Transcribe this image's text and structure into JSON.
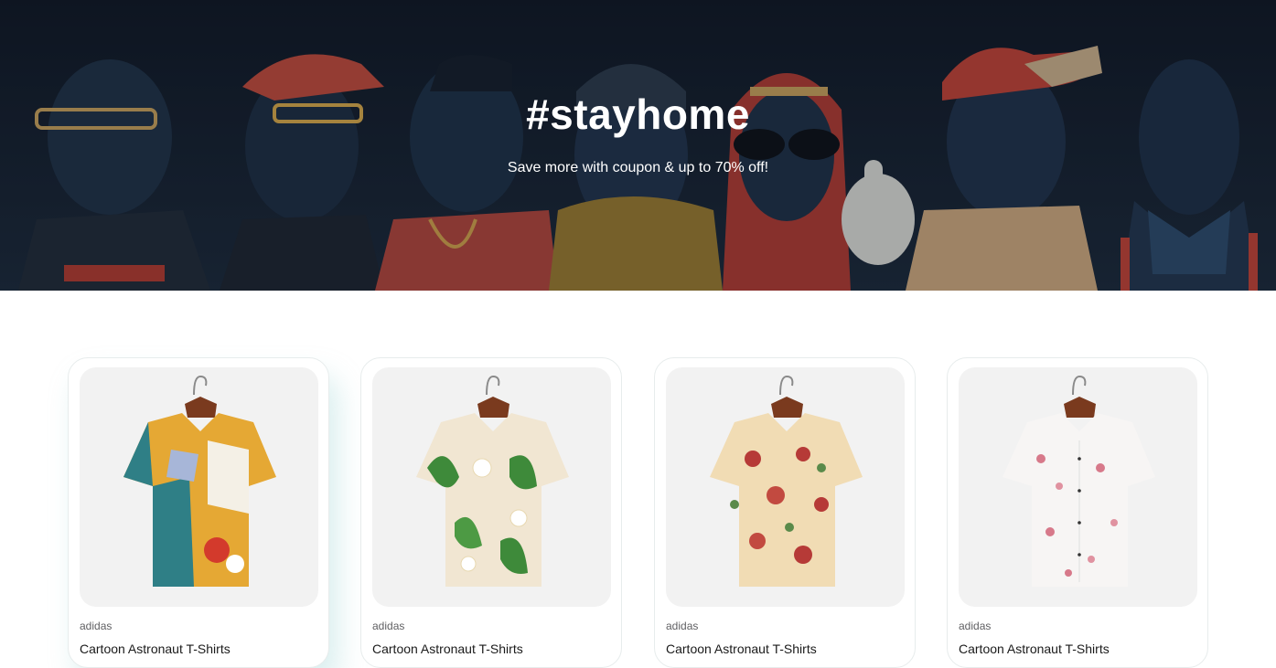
{
  "hero": {
    "title": "#stayhome",
    "subtitle": "Save more with coupon & up to 70% off!"
  },
  "products": [
    {
      "brand": "adidas",
      "name": "Cartoon Astronaut T-Shirts",
      "image_icon": "shirt-abstract-print-icon"
    },
    {
      "brand": "adidas",
      "name": "Cartoon Astronaut T-Shirts",
      "image_icon": "shirt-floral-green-icon"
    },
    {
      "brand": "adidas",
      "name": "Cartoon Astronaut T-Shirts",
      "image_icon": "shirt-floral-red-icon"
    },
    {
      "brand": "adidas",
      "name": "Cartoon Astronaut T-Shirts",
      "image_icon": "shirt-cherry-blossom-icon"
    }
  ],
  "colors": {
    "hero_bg": "#141d2b",
    "card_border": "#e7ecec",
    "image_bg": "#f2f2f2",
    "brand_text": "#606063",
    "name_text": "#1a1a1a"
  }
}
